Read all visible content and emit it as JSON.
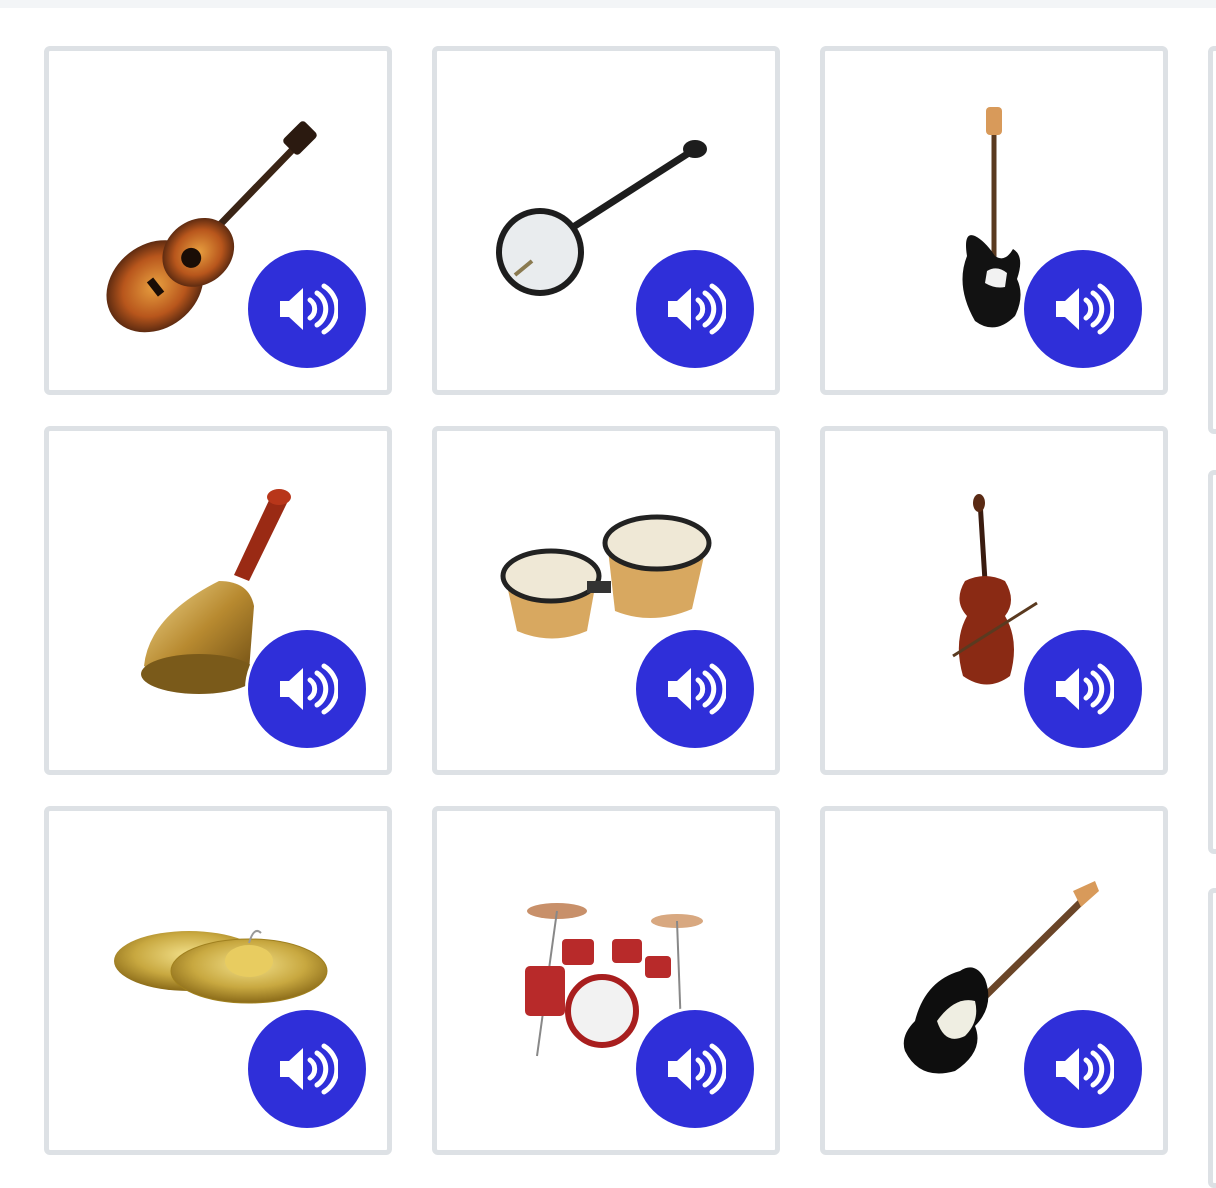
{
  "colors": {
    "accent": "#2f2fd9",
    "card_border": "#dde1e5",
    "background": "#ffffff"
  },
  "cards": [
    {
      "instrument": "acoustic-guitar",
      "icon": "speaker-icon"
    },
    {
      "instrument": "banjo",
      "icon": "speaker-icon"
    },
    {
      "instrument": "bass-guitar",
      "icon": "speaker-icon"
    },
    {
      "instrument": "hand-bell",
      "icon": "speaker-icon"
    },
    {
      "instrument": "bongo-drums",
      "icon": "speaker-icon"
    },
    {
      "instrument": "cello",
      "icon": "speaker-icon"
    },
    {
      "instrument": "cymbals",
      "icon": "speaker-icon"
    },
    {
      "instrument": "drum-kit",
      "icon": "speaker-icon"
    },
    {
      "instrument": "electric-guitar",
      "icon": "speaker-icon"
    }
  ]
}
